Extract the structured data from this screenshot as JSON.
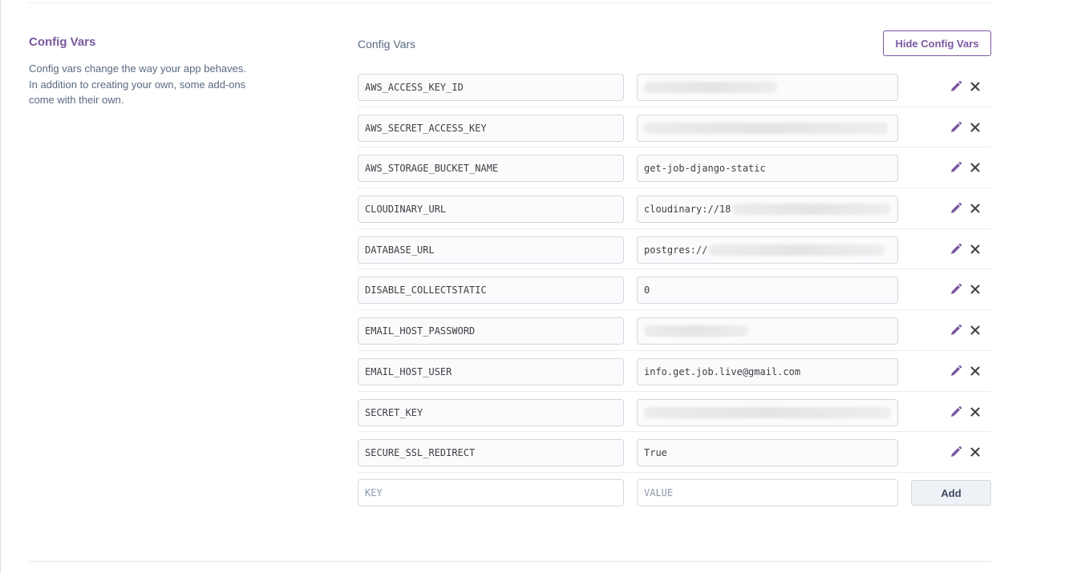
{
  "section": {
    "title": "Config Vars",
    "description": "Config vars change the way your app behaves. In addition to creating your own, some add-ons come with their own."
  },
  "panel": {
    "title": "Config Vars",
    "hide_button": "Hide Config Vars"
  },
  "vars": [
    {
      "key": "AWS_ACCESS_KEY_ID",
      "value": "",
      "value_redacted": true
    },
    {
      "key": "AWS_SECRET_ACCESS_KEY",
      "value": "",
      "value_redacted": true
    },
    {
      "key": "AWS_STORAGE_BUCKET_NAME",
      "value": "get-job-django-static",
      "value_redacted": false
    },
    {
      "key": "CLOUDINARY_URL",
      "value": "cloudinary://18",
      "value_redacted": true
    },
    {
      "key": "DATABASE_URL",
      "value": "postgres://",
      "value_redacted": true
    },
    {
      "key": "DISABLE_COLLECTSTATIC",
      "value": "0",
      "value_redacted": false
    },
    {
      "key": "EMAIL_HOST_PASSWORD",
      "value": "",
      "value_redacted": true
    },
    {
      "key": "EMAIL_HOST_USER",
      "value": "info.get.job.live@gmail.com",
      "value_redacted": false
    },
    {
      "key": "SECRET_KEY",
      "value": "",
      "value_redacted": true
    },
    {
      "key": "SECURE_SSL_REDIRECT",
      "value": "True",
      "value_redacted": false
    }
  ],
  "new_var": {
    "key_placeholder": "KEY",
    "value_placeholder": "VALUE",
    "add_button": "Add"
  },
  "icons": {
    "edit": "pencil-icon",
    "delete": "close-icon"
  },
  "colors": {
    "accent": "#79589f",
    "text_muted": "#596981",
    "close_icon": "#3f3f44"
  }
}
